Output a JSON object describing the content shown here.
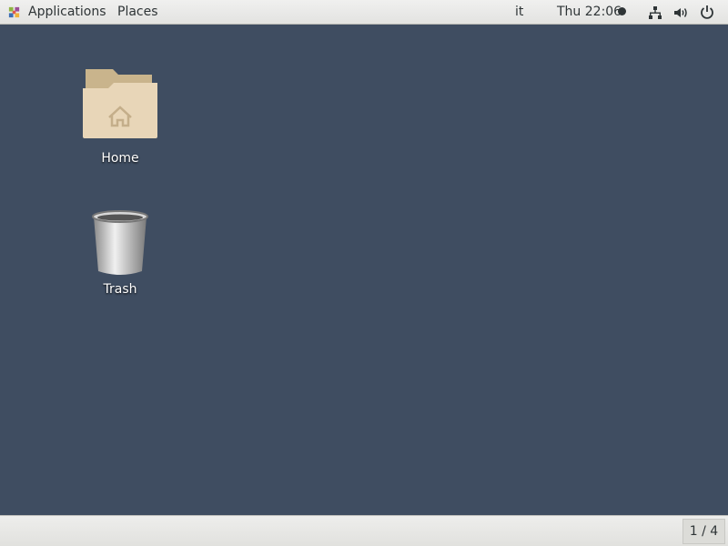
{
  "topbar": {
    "applications": "Applications",
    "places": "Places",
    "keyboard_layout": "it",
    "clock": "Thu 22:06"
  },
  "desktop": {
    "icons": [
      {
        "label": "Home"
      },
      {
        "label": "Trash"
      }
    ]
  },
  "bottombar": {
    "workspace": "1 / 4"
  }
}
